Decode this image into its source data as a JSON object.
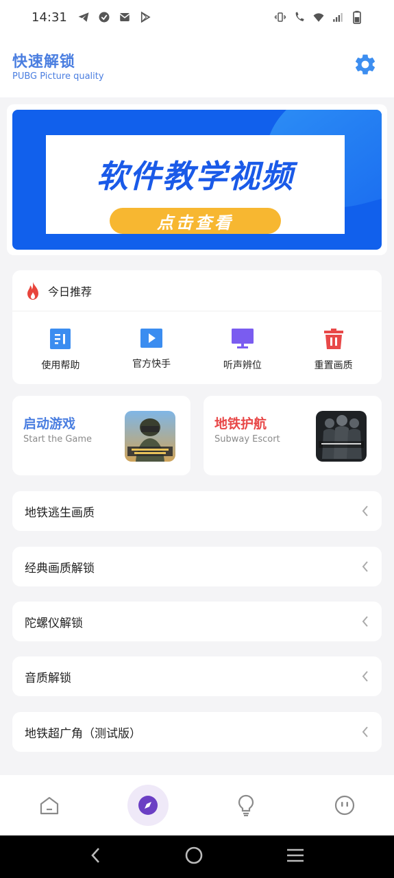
{
  "status": {
    "time": "14:31"
  },
  "header": {
    "title": "快速解锁",
    "subtitle": "PUBG Picture quality",
    "accent": "#4a7ee0"
  },
  "banner": {
    "headline": "软件教学视频",
    "cta": "点击查看"
  },
  "recommend": {
    "title": "今日推荐",
    "items": [
      {
        "label": "使用帮助",
        "icon": "document-icon",
        "color": "#3b8df0"
      },
      {
        "label": "官方快手",
        "icon": "play-icon",
        "color": "#3b8df0"
      },
      {
        "label": "听声辨位",
        "icon": "monitor-icon",
        "color": "#7a5cf0"
      },
      {
        "label": "重置画质",
        "icon": "trash-icon",
        "color": "#e84848"
      }
    ]
  },
  "games": [
    {
      "title": "启动游戏",
      "subtitle": "Start the Game",
      "color": "#4a7ee0"
    },
    {
      "title": "地铁护航",
      "subtitle": "Subway Escort",
      "color": "#e84848"
    }
  ],
  "menu": [
    {
      "label": "地铁逃生画质"
    },
    {
      "label": "经典画质解锁"
    },
    {
      "label": "陀螺仪解锁"
    },
    {
      "label": "音质解锁"
    },
    {
      "label": "地铁超广角（测试版）"
    }
  ],
  "bottom_nav": [
    {
      "icon": "home-icon",
      "active": false
    },
    {
      "icon": "compass-icon",
      "active": true
    },
    {
      "icon": "lightbulb-icon",
      "active": false
    },
    {
      "icon": "profile-face-icon",
      "active": false
    }
  ]
}
